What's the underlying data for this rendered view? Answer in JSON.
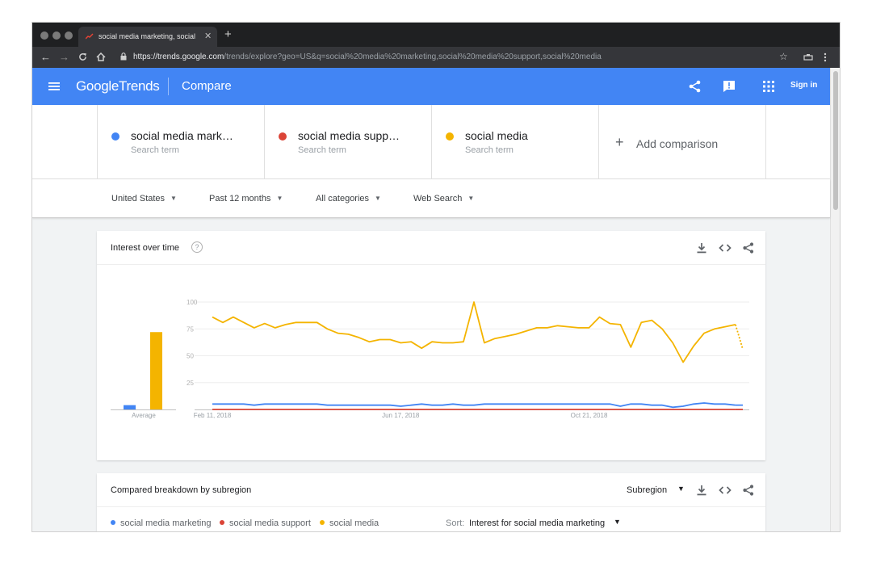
{
  "browser": {
    "tab_title": "social media marketing, social",
    "tab_close": "✕",
    "new_tab": "+",
    "url_host": "https://trends.google.com",
    "url_rest": "/trends/explore?geo=US&q=social%20media%20marketing,social%20media%20support,social%20media"
  },
  "header": {
    "logo_google": "Google",
    "logo_trends": "Trends",
    "title": "Compare",
    "signin": "Sign in",
    "brand_color": "#4285f4"
  },
  "terms": [
    {
      "name": "social media mark…",
      "sub": "Search term",
      "color": "#4285f4"
    },
    {
      "name": "social media supp…",
      "sub": "Search term",
      "color": "#db4437"
    },
    {
      "name": "social media",
      "sub": "Search term",
      "color": "#f4b400"
    }
  ],
  "add_comparison": {
    "icon": "+",
    "label": "Add comparison"
  },
  "filters": [
    {
      "label": "United States",
      "caret": "▼"
    },
    {
      "label": "Past 12 months",
      "caret": "▼"
    },
    {
      "label": "All categories",
      "caret": "▼"
    },
    {
      "label": "Web Search",
      "caret": "▼"
    }
  ],
  "interest_card": {
    "title": "Interest over time",
    "help": "?"
  },
  "chart_data": {
    "type": "line",
    "title": "",
    "y_ticks": [
      "100",
      "75",
      "50",
      "25"
    ],
    "ylim": [
      0,
      100
    ],
    "x_tick_labels": [
      "Feb 11, 2018",
      "Jun 17, 2018",
      "Oct 21, 2018"
    ],
    "x_tick_index": [
      0,
      18,
      36
    ],
    "average_label": "Average",
    "grid": true,
    "series": [
      {
        "color": "#4285f4",
        "average": 4,
        "values": [
          5,
          5,
          5,
          5,
          4,
          5,
          5,
          5,
          5,
          5,
          5,
          4,
          4,
          4,
          4,
          4,
          4,
          4,
          3,
          4,
          5,
          4,
          4,
          5,
          4,
          4,
          5,
          5,
          5,
          5,
          5,
          5,
          5,
          5,
          5,
          5,
          5,
          5,
          5,
          3,
          5,
          5,
          4,
          4,
          2,
          3,
          5,
          6,
          5,
          5,
          4
        ]
      },
      {
        "color": "#db4437",
        "average": 0,
        "values": [
          0,
          0,
          0,
          0,
          0,
          0,
          0,
          0,
          0,
          0,
          0,
          0,
          0,
          0,
          0,
          0,
          0,
          0,
          0,
          0,
          0,
          0,
          0,
          0,
          0,
          0,
          0,
          0,
          0,
          0,
          0,
          0,
          0,
          0,
          0,
          0,
          0,
          0,
          0,
          0,
          0,
          0,
          0,
          0,
          0,
          0,
          0,
          0,
          0,
          0,
          0
        ]
      },
      {
        "color": "#f4b400",
        "average": 72,
        "values": [
          86,
          81,
          86,
          81,
          76,
          80,
          76,
          79,
          81,
          81,
          81,
          75,
          71,
          70,
          67,
          63,
          65,
          65,
          62,
          63,
          57,
          63,
          62,
          62,
          63,
          100,
          62,
          66,
          68,
          70,
          73,
          76,
          76,
          78,
          77,
          76,
          76,
          86,
          80,
          79,
          58,
          81,
          83,
          75,
          62,
          44,
          59,
          71,
          75,
          77,
          79
        ],
        "partial_last": 56
      }
    ]
  },
  "breakdown_card": {
    "title": "Compared breakdown by subregion",
    "selector": "Subregion",
    "caret": "▼",
    "legend": [
      {
        "name": "social media marketing",
        "color": "#4285f4"
      },
      {
        "name": "social media support",
        "color": "#db4437"
      },
      {
        "name": "social media",
        "color": "#f4b400"
      }
    ],
    "sort_label": "Sort:",
    "sort_value": "Interest for social media marketing"
  }
}
